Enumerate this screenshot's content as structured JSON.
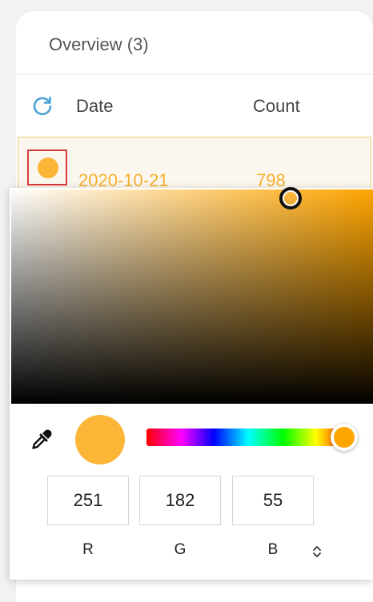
{
  "overview": {
    "title": "Overview (3)"
  },
  "table": {
    "columns": [
      "Date",
      "Count"
    ],
    "rows": [
      {
        "date": "2020-10-21",
        "count": "798"
      }
    ]
  },
  "colors": {
    "selected": "#fbb637",
    "row_text": "#f5b02e",
    "row_highlight": "#fbf7ee",
    "swatch_border": "#d93a3a",
    "refresh_icon": "#4aa3d8",
    "hue_handle": "#ffa500"
  },
  "picker": {
    "r": "251",
    "g": "182",
    "b": "55",
    "labels": {
      "r": "R",
      "g": "G",
      "b": "B"
    },
    "mode_toggle_glyph": "⌃⌄",
    "hue_fraction": 0.97
  },
  "icons": {
    "refresh": "refresh-icon",
    "eyedropper": "eyedropper-icon",
    "mode_toggle": "chevron-up-down-icon"
  }
}
